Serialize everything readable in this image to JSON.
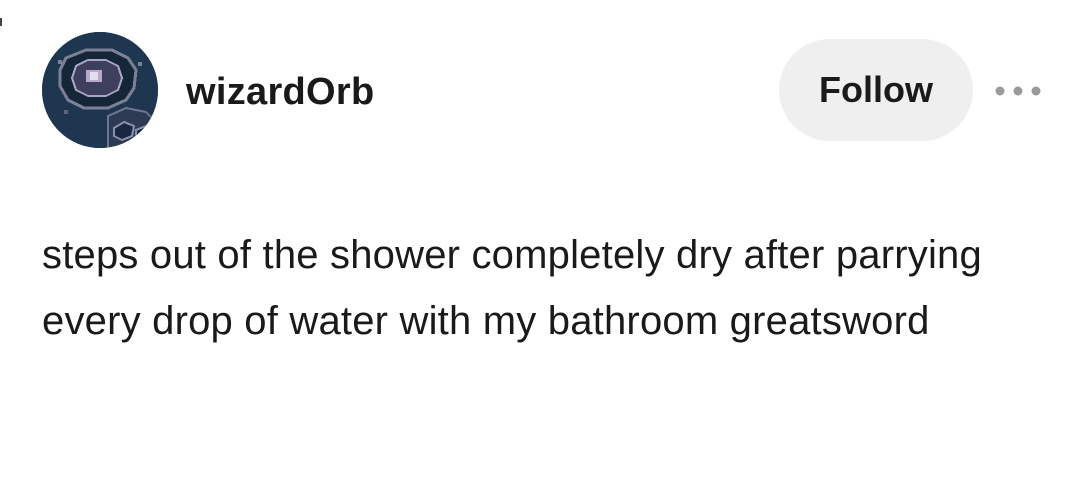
{
  "post": {
    "author": {
      "username": "wizardOrb",
      "avatar_icon": "pixel-orb-avatar"
    },
    "follow_label": "Follow",
    "more_icon": "more-horizontal-icon",
    "text": "steps out of the shower completely dry after parrying every drop of water with my bathroom greatsword"
  },
  "colors": {
    "background": "#ffffff",
    "text": "#1a1a1a",
    "follow_button_bg": "#efefef",
    "avatar_bg": "#1e3650",
    "more_dots": "#9a9a9a"
  }
}
